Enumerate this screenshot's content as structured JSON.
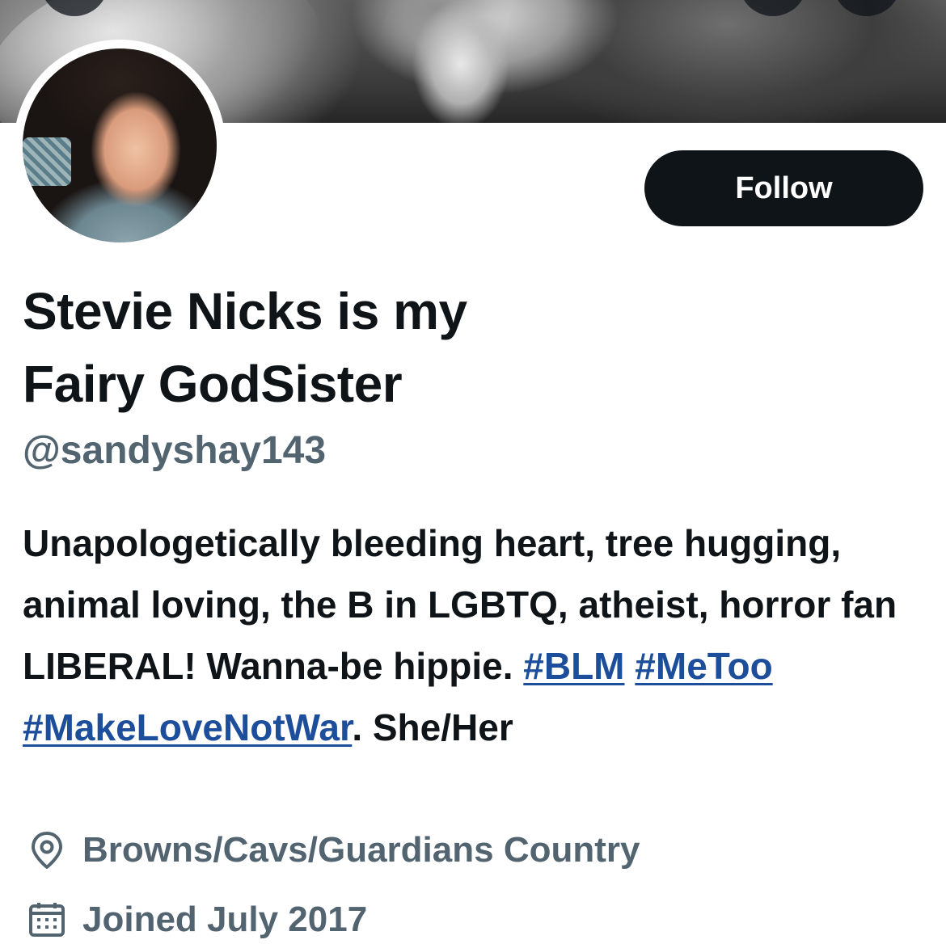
{
  "profile": {
    "follow_label": "Follow",
    "display_name_line1": "Stevie Nicks is my",
    "display_name_line2": "Fairy GodSister",
    "handle": "@sandyshay143",
    "bio": {
      "text_1": "Unapologetically bleeding heart, tree hugging, animal loving, the B in LGBTQ, atheist, horror fan LIBERAL! Wanna-be hippie. ",
      "hashtag_1": "#BLM",
      "space_1": " ",
      "hashtag_2": "#MeToo",
      "space_2": " ",
      "hashtag_3": "#MakeLoveNotWar",
      "text_2": ". She/Her"
    },
    "location": "Browns/Cavs/Guardians Country",
    "joined": "Joined July 2017"
  },
  "icons": {
    "location": "location-pin-icon",
    "joined": "calendar-icon"
  },
  "colors": {
    "text": "#0f1419",
    "secondary": "#536471",
    "link": "#1d4e9b",
    "button_bg": "#0f1419",
    "button_text": "#ffffff"
  }
}
